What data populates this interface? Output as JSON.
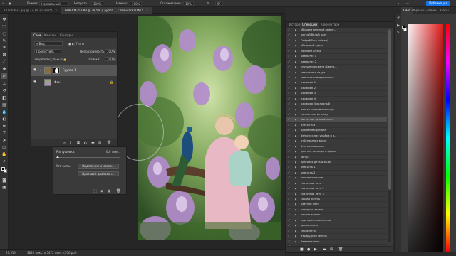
{
  "optbar": {
    "mode_label": "Режим:",
    "mode_value": "Нормальный",
    "opacity_label": "Непрозр.:",
    "opacity_value": "100%",
    "press_label": "Нажим:",
    "press_value": "100%",
    "smoothing_label": "Сглаживание:",
    "smoothing_value": "10%",
    "angle_value": "0°",
    "share_label": "Публикация"
  },
  "tabs": [
    {
      "label": "GUR70633.jpg @ 33,3% (RGB/8*)"
    },
    {
      "label": "GUR70635.CR3 @ 29,5% (Группа 1, Слой-маска/16) *"
    }
  ],
  "layers_panel": {
    "tabs": [
      "Слои",
      "Каналы",
      "Контуры"
    ],
    "kind_label": "Вид",
    "blend_value": "Пропустить",
    "opacity_label": "Непрозрачность:",
    "opacity_value": "100%",
    "lock_label": "Закрепить:",
    "fill_label": "Заливка:",
    "fill_value": "100%",
    "layers": [
      {
        "name": "Группа 1"
      },
      {
        "name": "Фон"
      }
    ]
  },
  "props_panel": {
    "feather_label": "Растушевка:",
    "feather_value": "0,0 пикс.",
    "refine_label": "Уточнить:",
    "btn_select_mask": "Выделение и маска...",
    "btn_color_range": "Цветовой диапазон..."
  },
  "ops_panel": {
    "tabs": [
      "История",
      "Операции",
      "Комментари"
    ],
    "items": [
      {
        "label": "убираем зеленый рефле..."
      },
      {
        "label": "чистый белый цвет"
      },
      {
        "label": "DodgeNBurn (объем)"
      },
      {
        "label": "объемный туман"
      },
      {
        "label": "убираем шумы"
      },
      {
        "label": "размытие 1"
      },
      {
        "label": "размытие 2"
      },
      {
        "label": "улучшение цвета (Цвета..."
      },
      {
        "label": "светимость кадра"
      },
      {
        "label": "четкость и микроконтра..."
      },
      {
        "label": "оживляж 1"
      },
      {
        "label": "оживляж 2"
      },
      {
        "label": "оживляж 3"
      },
      {
        "label": "оживляж 4"
      },
      {
        "label": "оживляж 4 холодный"
      },
      {
        "label": "только прядями текстур..."
      },
      {
        "label": "только снятие кожу"
      },
      {
        "label": "частотное разложение..."
      },
      {
        "label": "блеск глаз"
      },
      {
        "label": "добавляем румяна"
      },
      {
        "label": "белоснежная улыбка и в..."
      },
      {
        "label": "отбеливание волос"
      },
      {
        "label": "блеск на волосах"
      },
      {
        "label": "краткие ресницы и брови"
      },
      {
        "label": "загар"
      },
      {
        "label": "красивая детализация"
      },
      {
        "label": "резкость 1"
      },
      {
        "label": "резкость 2"
      },
      {
        "label": "винтажирование"
      },
      {
        "label": "сказочная лето 1"
      },
      {
        "label": "сказочная лето 2"
      },
      {
        "label": "сказочная лето 3"
      },
      {
        "label": "сочная зелень"
      },
      {
        "label": "цветное лето"
      },
      {
        "label": "холодная зелень"
      },
      {
        "label": "теплая зелень"
      },
      {
        "label": "приглушенная зелень"
      },
      {
        "label": "яркая зелень"
      },
      {
        "label": "серое лето"
      },
      {
        "label": "изумрудная зелень"
      },
      {
        "label": "бежевое лето"
      },
      {
        "label": "глубокое лето"
      }
    ],
    "selected_index": 17
  },
  "color_panel": {
    "tabs": [
      "Цвет",
      "Образцы",
      "Градиен",
      "Узоры"
    ]
  },
  "statusbar": {
    "zoom": "29,51%",
    "doc_info": "3840 пикс. x 5472 пикс. (300 ppi)"
  }
}
